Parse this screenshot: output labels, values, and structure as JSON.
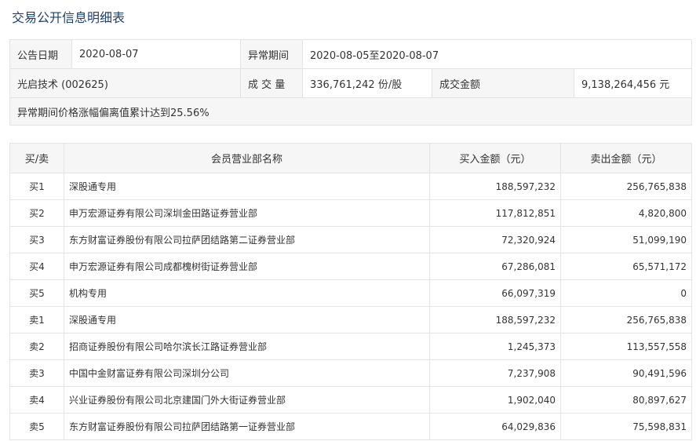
{
  "page": {
    "title": "交易公开信息明细表"
  },
  "summary": {
    "announce_date_label": "公告日期",
    "announce_date": "2020-08-07",
    "period_label": "异常期间",
    "period": "2020-08-05至2020-08-07",
    "stock": "光启技术 (002625)",
    "volume_label": "成 交 量",
    "volume": "336,761,242 份/股",
    "amount_label": "成交金额",
    "amount": "9,138,264,456 元",
    "note": "异常期间价格涨幅偏离值累计达到25.56%"
  },
  "table": {
    "headers": [
      "买/卖",
      "会员营业部名称",
      "买入金额（元）",
      "卖出金额（元）"
    ],
    "rows": [
      {
        "side": "买1",
        "name": "深股通专用",
        "buy": "188,597,232",
        "sell": "256,765,838"
      },
      {
        "side": "买2",
        "name": "申万宏源证券有限公司深圳金田路证券营业部",
        "buy": "117,812,851",
        "sell": "4,820,800"
      },
      {
        "side": "买3",
        "name": "东方财富证券股份有限公司拉萨团结路第二证券营业部",
        "buy": "72,320,924",
        "sell": "51,099,190"
      },
      {
        "side": "买4",
        "name": "申万宏源证券有限公司成都槐树街证券营业部",
        "buy": "67,286,081",
        "sell": "65,571,172"
      },
      {
        "side": "买5",
        "name": "机构专用",
        "buy": "66,097,319",
        "sell": "0"
      },
      {
        "side": "卖1",
        "name": "深股通专用",
        "buy": "188,597,232",
        "sell": "256,765,838"
      },
      {
        "side": "卖2",
        "name": "招商证券股份有限公司哈尔滨长江路证券营业部",
        "buy": "1,245,373",
        "sell": "113,557,558"
      },
      {
        "side": "卖3",
        "name": "中国中金财富证券有限公司深圳分公司",
        "buy": "7,237,908",
        "sell": "90,491,596"
      },
      {
        "side": "卖4",
        "name": "兴业证券股份有限公司北京建国门外大街证券营业部",
        "buy": "1,902,040",
        "sell": "80,897,627"
      },
      {
        "side": "卖5",
        "name": "东方财富证券股份有限公司拉萨团结路第一证券营业部",
        "buy": "64,029,836",
        "sell": "75,598,831"
      }
    ]
  }
}
